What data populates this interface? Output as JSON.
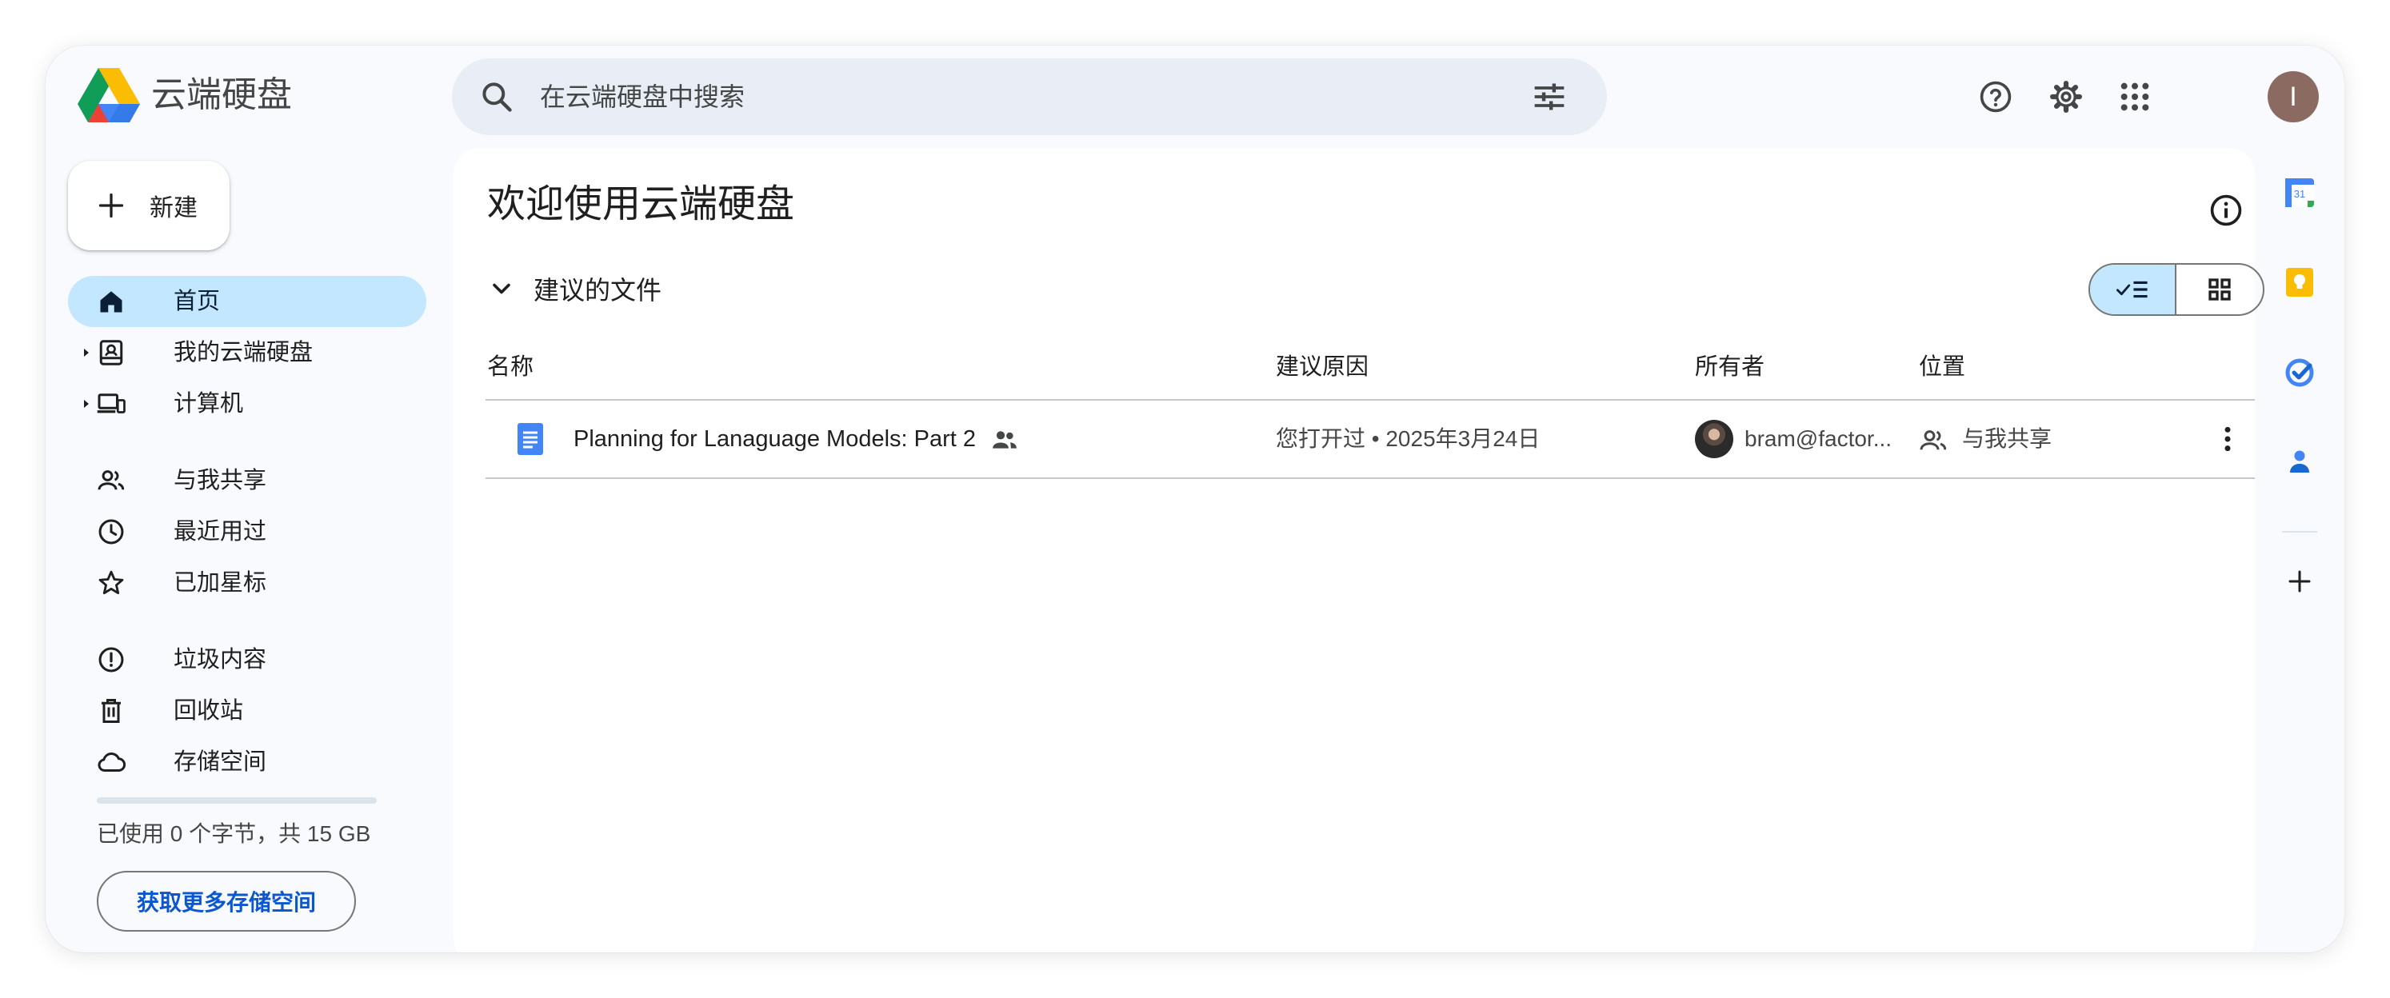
{
  "app": {
    "title": "云端硬盘"
  },
  "search": {
    "placeholder": "在云端硬盘中搜索"
  },
  "user": {
    "initial": "I"
  },
  "nav": {
    "new_label": "新建",
    "items": [
      {
        "label": "首页",
        "icon": "home-icon",
        "active": true
      },
      {
        "label": "我的云端硬盘",
        "icon": "my-drive-icon"
      },
      {
        "label": "计算机",
        "icon": "computers-icon"
      },
      {
        "label": "与我共享",
        "icon": "shared-icon"
      },
      {
        "label": "最近用过",
        "icon": "clock-icon"
      },
      {
        "label": "已加星标",
        "icon": "star-icon"
      },
      {
        "label": "垃圾内容",
        "icon": "spam-icon"
      },
      {
        "label": "回收站",
        "icon": "trash-icon"
      },
      {
        "label": "存储空间",
        "icon": "cloud-icon"
      }
    ],
    "storage_used_fraction": 0,
    "storage_text": "已使用 0 个字节，共 15 GB",
    "more_storage_label": "获取更多存储空间"
  },
  "main": {
    "title": "欢迎使用云端硬盘",
    "section_title": "建议的文件",
    "columns": {
      "name": "名称",
      "reason": "建议原因",
      "owner": "所有者",
      "location": "位置"
    },
    "files": [
      {
        "name": "Planning for Lanaguage Models: Part 2",
        "reason": "您打开过 • 2025年3月24日",
        "owner": "bram@factor...",
        "location": "与我共享"
      }
    ]
  },
  "side_panel": {
    "apps": [
      "calendar-icon",
      "keep-icon",
      "tasks-icon",
      "contacts-icon",
      "add-icon"
    ],
    "calendar_day": "31"
  },
  "colors": {
    "active_nav": "#c2e7ff",
    "link": "#0b57d0",
    "doc_blue": "#4285f4"
  }
}
